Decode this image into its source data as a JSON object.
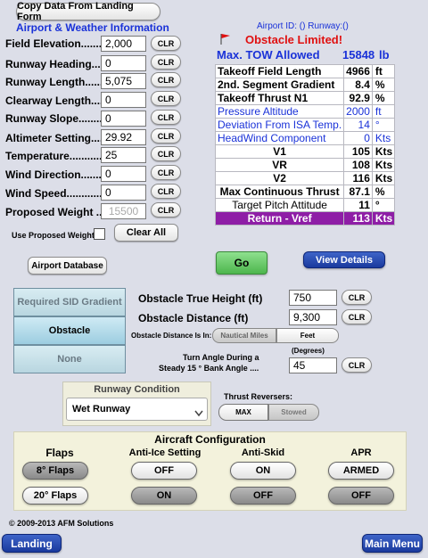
{
  "top": {
    "copy_button": "Copy Data From Landing Form",
    "section_title": "Airport & Weather Information",
    "airport_id_text": "Airport ID: () Runway:()"
  },
  "fields": [
    {
      "label": "Field Elevation........",
      "value": "2,000",
      "clr": "CLR"
    },
    {
      "label": "Runway Heading.......",
      "value": "0",
      "clr": "CLR"
    },
    {
      "label": "Runway Length.........",
      "value": "5,075",
      "clr": "CLR"
    },
    {
      "label": "Clearway Length.......",
      "value": "0",
      "clr": "CLR"
    },
    {
      "label": "Runway Slope..........",
      "value": "0",
      "clr": "CLR"
    },
    {
      "label": "Altimeter Setting......",
      "value": "29.92",
      "clr": "CLR"
    },
    {
      "label": "Temperature.............",
      "value": "25",
      "clr": "CLR"
    },
    {
      "label": "Wind Direction..........",
      "value": "0",
      "clr": "CLR"
    },
    {
      "label": "Wind Speed...............",
      "value": "0",
      "clr": "CLR"
    },
    {
      "label": "Proposed Weight ....",
      "value": "",
      "placeholder": "15500",
      "clr": "CLR"
    }
  ],
  "use_proposed_weight": "Use Proposed Weight",
  "clear_all": "Clear All",
  "obstacle_limited": "Obstacle Limited!",
  "max_tow": {
    "label": "Max. TOW Allowed",
    "value": "15848",
    "unit": "lb"
  },
  "results": [
    {
      "label": "Takeoff Field Length",
      "value": "4966",
      "unit": "ft",
      "style": "bold"
    },
    {
      "label": "2nd. Segment Gradient",
      "value": "8.4",
      "unit": "%",
      "style": "bold"
    },
    {
      "label": "Takeoff Thrust N1",
      "value": "92.9",
      "unit": "%",
      "style": "bold"
    },
    {
      "label": "Pressure Altitude",
      "value": "2000",
      "unit": "ft",
      "style": "blue"
    },
    {
      "label": "Deviation From ISA Temp.",
      "value": "14",
      "unit": "°",
      "style": "blue"
    },
    {
      "label": "HeadWind Component",
      "value": "0",
      "unit": "Kts",
      "style": "blue"
    },
    {
      "label": "V1",
      "value": "105",
      "unit": "Kts",
      "style": "center"
    },
    {
      "label": "VR",
      "value": "108",
      "unit": "Kts",
      "style": "center"
    },
    {
      "label": "V2",
      "value": "116",
      "unit": "Kts",
      "style": "center"
    },
    {
      "label": "Max Continuous Thrust",
      "value": "87.1",
      "unit": "%",
      "style": "center"
    },
    {
      "label": "Target Pitch Attitude",
      "value": "11",
      "unit": "°",
      "style": "center-normal"
    },
    {
      "label": "Return - Vref",
      "value": "113",
      "unit": "Kts",
      "style": "purple"
    }
  ],
  "buttons": {
    "airport_database": "Airport Database",
    "view_details": "View Details",
    "go": "Go",
    "landing": "Landing",
    "main_menu": "Main Menu"
  },
  "sid": {
    "required_sid_gradient": "Required SID Gradient",
    "obstacle": "Obstacle",
    "none": "None"
  },
  "obstacle": {
    "height_label": "Obstacle True Height (ft)",
    "height_value": "750",
    "distance_label": "Obstacle Distance (ft)",
    "distance_value": "9,300",
    "distance_in_label": "Obstacle Distance Is In:",
    "nautical_miles": "Nautical Miles",
    "feet": "Feet",
    "degrees_label": "(Degrees)",
    "turn_label_1": "Turn Angle During a",
    "turn_label_2": "Steady 15 ° Bank Angle ....",
    "turn_value": "45",
    "clr": "CLR"
  },
  "runway_condition": {
    "title": "Runway Condition",
    "selected": "Wet Runway"
  },
  "thrust_reversers": {
    "title": "Thrust Reversers:",
    "max": "MAX",
    "stowed": "Stowed"
  },
  "aircraft_config": {
    "title": "Aircraft Configuration",
    "flaps_head": "Flaps",
    "anti_ice_head": "Anti-Ice Setting",
    "anti_skid_head": "Anti-Skid",
    "apr_head": "APR",
    "flaps8": "8° Flaps",
    "flaps20": "20° Flaps",
    "anti_ice_off": "OFF",
    "anti_ice_on": "ON",
    "anti_skid_on": "ON",
    "anti_skid_off": "OFF",
    "apr_armed": "ARMED",
    "apr_off": "OFF"
  },
  "copyright": "© 2009-2013 AFM Solutions",
  "colors": {
    "accent_blue": "#1a32d8",
    "warning_red": "#e01010",
    "vref_purple": "#8e1ea6",
    "go_green": "#5cc45c"
  }
}
